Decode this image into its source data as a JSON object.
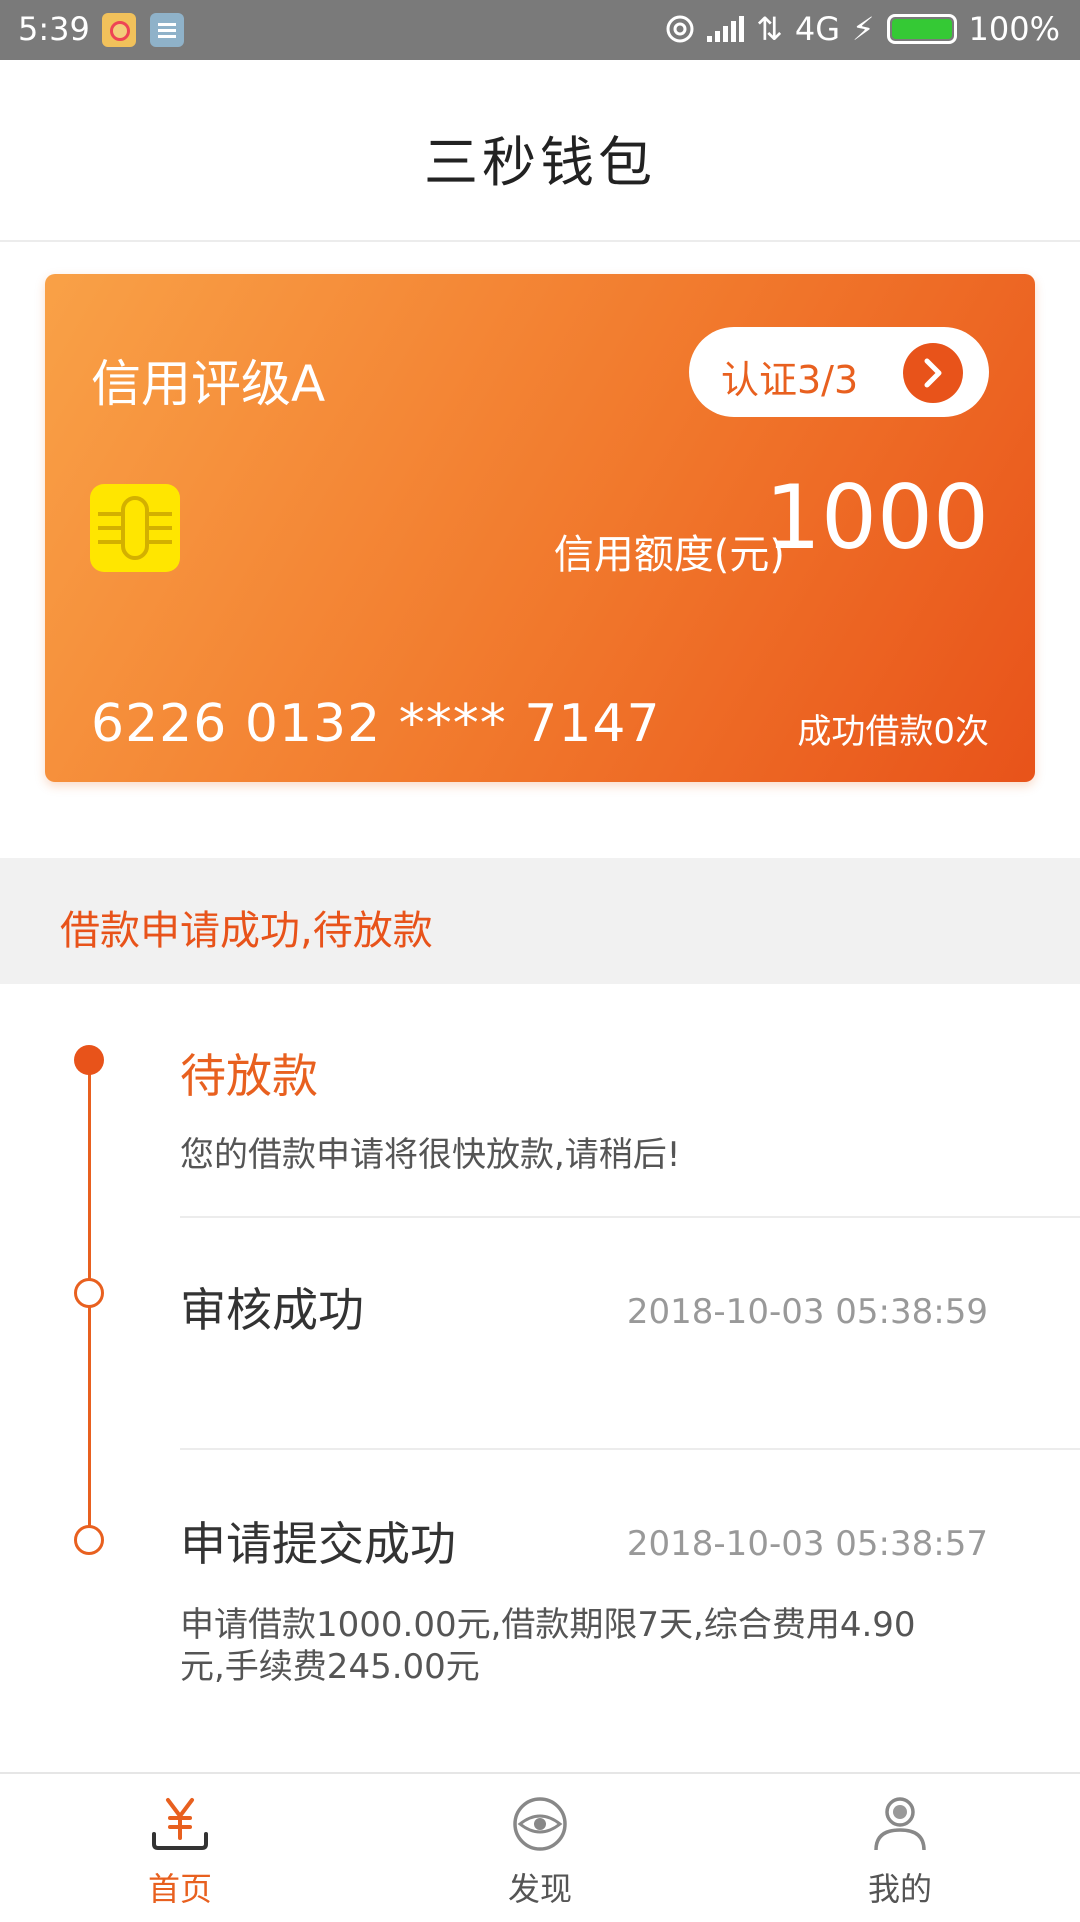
{
  "status_bar": {
    "time": "5:39",
    "network": "4G",
    "battery": "100%"
  },
  "header": {
    "title": "三秒钱包"
  },
  "card": {
    "rating": "信用评级A",
    "auth_label": "认证3/3",
    "limit_label": "信用额度(元)",
    "limit_value": "1000",
    "card_number": "6226 0132 **** 7147",
    "loan_count": "成功借款0次"
  },
  "status_strip": {
    "text": "借款申请成功,待放款"
  },
  "timeline": {
    "steps": [
      {
        "title": "待放款",
        "desc": "您的借款申请将很快放款,请稍后!"
      },
      {
        "title": "审核成功",
        "time": "2018-10-03 05:38:59"
      },
      {
        "title": "申请提交成功",
        "time": "2018-10-03 05:38:57",
        "desc_line1": "申请借款1000.00元,借款期限7天,综合费用4.90",
        "desc_line2": "元,手续费245.00元"
      }
    ]
  },
  "tabbar": {
    "tabs": [
      {
        "label": "首页",
        "icon": "yuan-icon",
        "active": true
      },
      {
        "label": "发现",
        "icon": "eye-icon",
        "active": false
      },
      {
        "label": "我的",
        "icon": "user-icon",
        "active": false
      }
    ]
  },
  "colors": {
    "accent": "#e8601f",
    "card_gradient_start": "#f9a147",
    "card_gradient_end": "#e8531a",
    "chip": "#ffe600",
    "status_strip_bg": "#f1f1f1"
  }
}
